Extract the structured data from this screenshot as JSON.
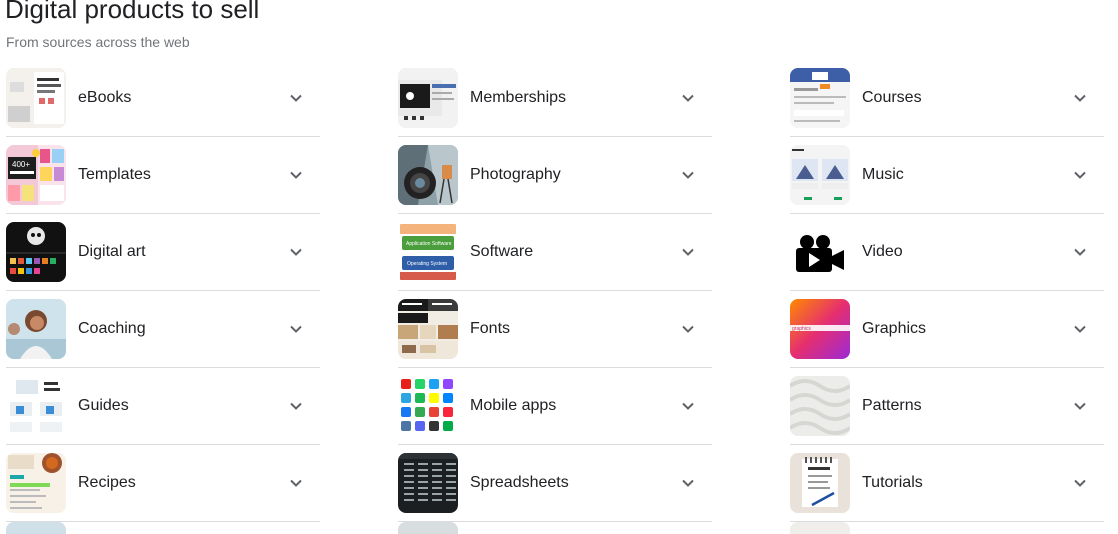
{
  "header": {
    "title": "Digital products to sell",
    "subtitle": "From sources across the web"
  },
  "items": [
    {
      "label": "eBooks",
      "icon": "ebook-thumbnail"
    },
    {
      "label": "Memberships",
      "icon": "memberships-thumbnail"
    },
    {
      "label": "Courses",
      "icon": "courses-thumbnail"
    },
    {
      "label": "Templates",
      "icon": "templates-thumbnail"
    },
    {
      "label": "Photography",
      "icon": "photography-thumbnail"
    },
    {
      "label": "Music",
      "icon": "music-thumbnail"
    },
    {
      "label": "Digital art",
      "icon": "digital-art-thumbnail"
    },
    {
      "label": "Software",
      "icon": "software-thumbnail"
    },
    {
      "label": "Video",
      "icon": "video-camera-icon"
    },
    {
      "label": "Coaching",
      "icon": "coaching-thumbnail"
    },
    {
      "label": "Fonts",
      "icon": "fonts-thumbnail"
    },
    {
      "label": "Graphics",
      "icon": "graphics-thumbnail"
    },
    {
      "label": "Guides",
      "icon": "guides-thumbnail"
    },
    {
      "label": "Mobile apps",
      "icon": "mobile-apps-thumbnail"
    },
    {
      "label": "Patterns",
      "icon": "patterns-thumbnail"
    },
    {
      "label": "Recipes",
      "icon": "recipes-thumbnail"
    },
    {
      "label": "Spreadsheets",
      "icon": "spreadsheets-thumbnail"
    },
    {
      "label": "Tutorials",
      "icon": "tutorials-thumbnail"
    }
  ],
  "thumb_text": {
    "templates_400": "400+",
    "software_app": "Application Software",
    "software_os": "Operating System",
    "graphics_word": "graphics"
  },
  "colors": {
    "text": "#202124",
    "muted": "#70757a",
    "divider": "#dadce0",
    "chevron": "#5f6368"
  }
}
